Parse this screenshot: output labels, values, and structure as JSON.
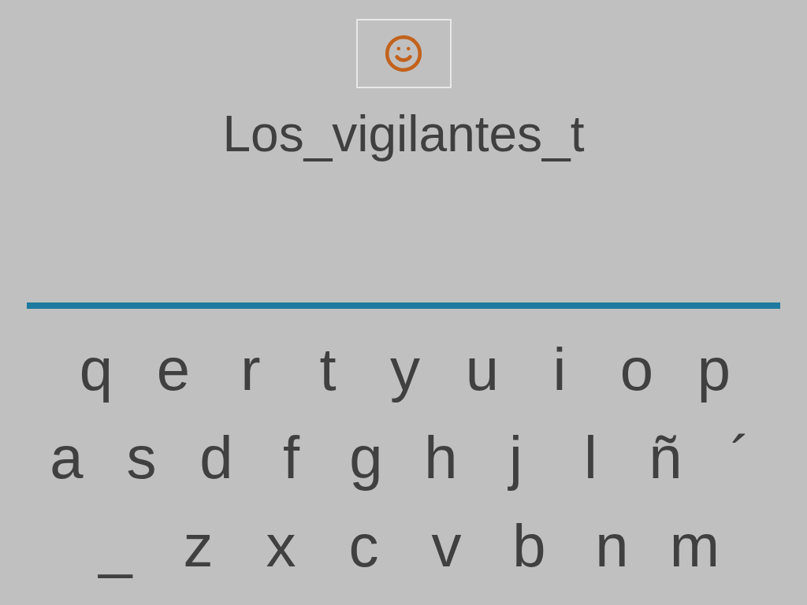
{
  "status_icon": {
    "kind": "smiley"
  },
  "word": "Los_vigilantes_t",
  "keyboard": [
    [
      "q",
      "e",
      "r",
      "t",
      "y",
      "u",
      "i",
      "o",
      "p"
    ],
    [
      "a",
      "s",
      "d",
      "f",
      "g",
      "h",
      "j",
      "l",
      "ñ",
      "´"
    ],
    [
      "_",
      "z",
      "x",
      "c",
      "v",
      "b",
      "n",
      "m"
    ]
  ]
}
